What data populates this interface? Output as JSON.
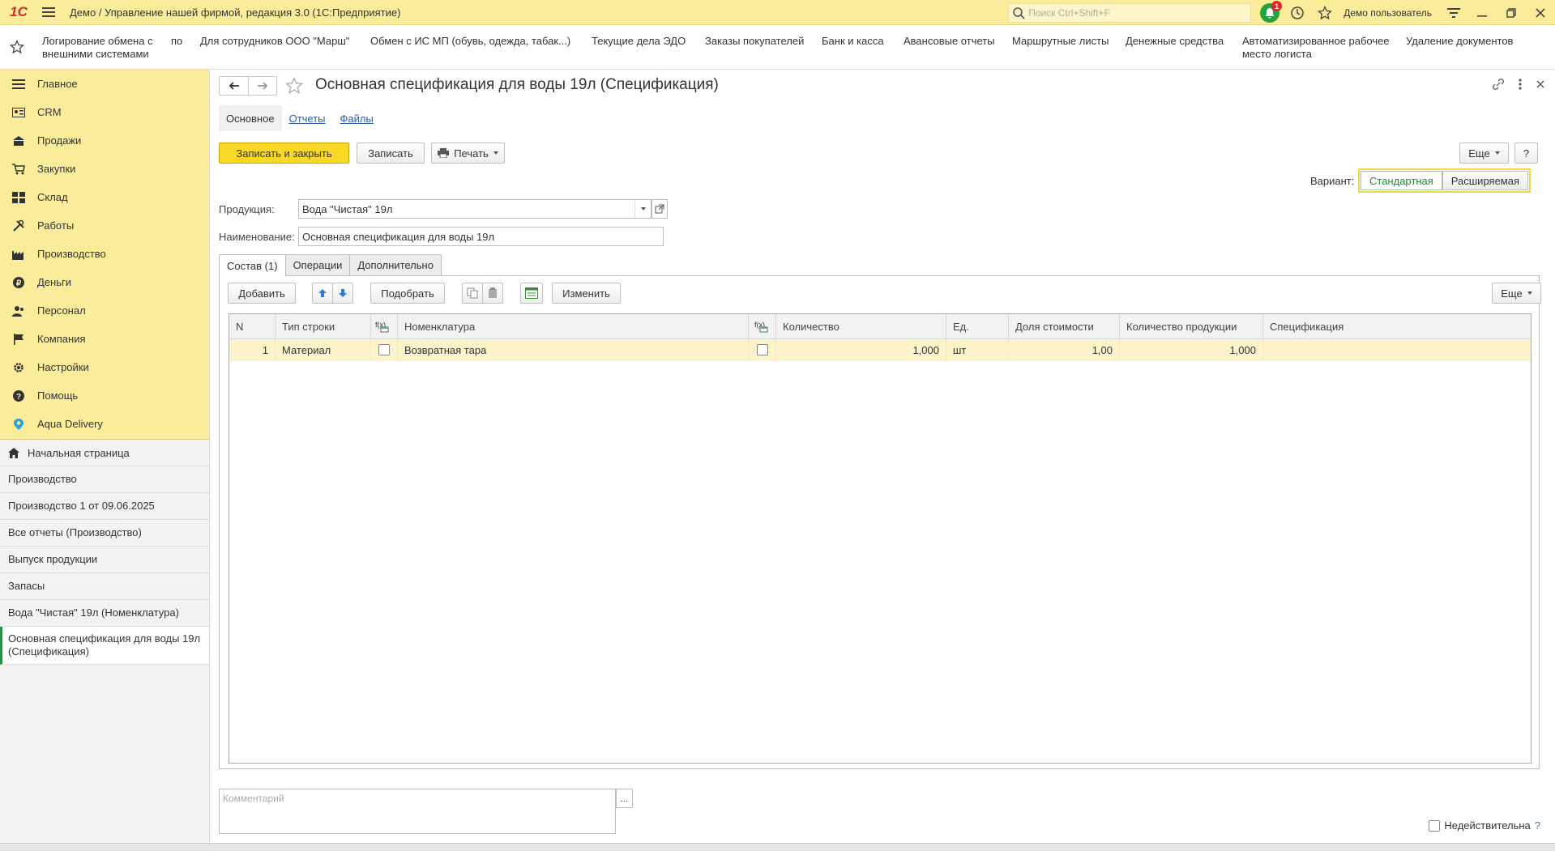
{
  "titlebar": {
    "logo": "1С",
    "title": "Демо / Управление нашей фирмой, редакция 3.0  (1С:Предприятие)",
    "search_placeholder": "Поиск Ctrl+Shift+F",
    "notification_count": "1",
    "user": "Демо пользователь"
  },
  "favorites": [
    {
      "label": "Логирование обмена с\nвнешними системами"
    },
    {
      "label": "по"
    },
    {
      "label": "Для сотрудников ООО \"Марш\""
    },
    {
      "label": "Обмен с ИС МП (обувь, одежда, табак...)"
    },
    {
      "label": "Текущие дела ЭДО"
    },
    {
      "label": "Заказы покупателей"
    },
    {
      "label": "Банк и касса"
    },
    {
      "label": "Авансовые отчеты"
    },
    {
      "label": "Маршрутные листы"
    },
    {
      "label": "Денежные средства"
    },
    {
      "label": "Автоматизированное рабочее\nместо логиста"
    },
    {
      "label": "Удаление документов"
    }
  ],
  "sections": [
    {
      "label": "Главное",
      "icon": "menu-lines-icon"
    },
    {
      "label": "CRM",
      "icon": "crm-icon"
    },
    {
      "label": "Продажи",
      "icon": "sales-icon"
    },
    {
      "label": "Закупки",
      "icon": "cart-icon"
    },
    {
      "label": "Склад",
      "icon": "warehouse-icon"
    },
    {
      "label": "Работы",
      "icon": "tools-icon"
    },
    {
      "label": "Производство",
      "icon": "factory-icon"
    },
    {
      "label": "Деньги",
      "icon": "money-icon"
    },
    {
      "label": "Персонал",
      "icon": "people-icon"
    },
    {
      "label": "Компания",
      "icon": "flag-icon"
    },
    {
      "label": "Настройки",
      "icon": "gear-icon"
    },
    {
      "label": "Помощь",
      "icon": "help-icon"
    },
    {
      "label": "Aqua Delivery",
      "icon": "location-icon"
    }
  ],
  "home": "Начальная страница",
  "open_windows": [
    "Производство",
    "Производство 1 от 09.06.2025",
    "Все отчеты (Производство)",
    "Выпуск продукции",
    "Запасы",
    "Вода \"Чистая\" 19л (Номенклатура)",
    "Основная спецификация для воды 19л (Спецификация)"
  ],
  "form": {
    "title": "Основная спецификация для воды 19л (Спецификация)",
    "tabs": [
      "Основное",
      "Отчеты",
      "Файлы"
    ],
    "save_close": "Записать и закрыть",
    "save": "Записать",
    "print": "Печать",
    "more": "Еще",
    "help": "?",
    "variant_label": "Вариант:",
    "variant_standard": "Стандартная",
    "variant_extended": "Расширяемая",
    "product_label": "Продукция:",
    "product_value": "Вода \"Чистая\" 19л",
    "name_label": "Наименование:",
    "name_value": "Основная спецификация для воды 19л",
    "inner_tabs": [
      "Состав (1)",
      "Операции",
      "Дополнительно"
    ],
    "add": "Добавить",
    "pick": "Подобрать",
    "change": "Изменить",
    "grid_more": "Еще",
    "columns": [
      "N",
      "Тип строки",
      "",
      "Номенклатура",
      "",
      "Количество",
      "Ед.",
      "Доля стоимости",
      "Количество продукции",
      "Спецификация"
    ],
    "rows": [
      {
        "n": "1",
        "type": "Материал",
        "nom": "Возвратная тара",
        "qty": "1,000",
        "unit": "шт",
        "share": "1,00",
        "prod_qty": "1,000",
        "spec": ""
      }
    ],
    "comment_placeholder": "Комментарий",
    "comment_btn": "...",
    "inactive_label": "Недействительна",
    "inactive_help": "?"
  }
}
